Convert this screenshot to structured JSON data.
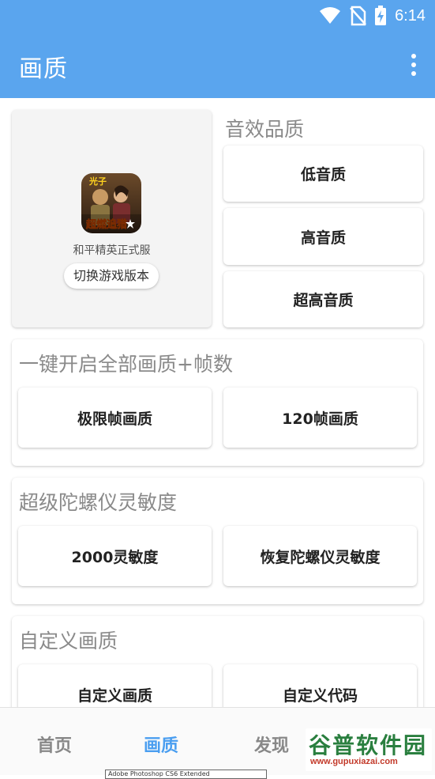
{
  "status_bar": {
    "time": "6:14",
    "icons": [
      "wifi-icon",
      "no-sim-icon",
      "battery-charging-icon"
    ]
  },
  "app_bar": {
    "title": "画质",
    "menu_icon": "more-vert-icon"
  },
  "game_card": {
    "icon_text_top": "光子",
    "icon_text_main": "超燃追猎",
    "name": "和平精英正式服",
    "switch_label": "切换游戏版本"
  },
  "sound_quality": {
    "title": "音效品质",
    "buttons": [
      "低音质",
      "高音质",
      "超高音质"
    ]
  },
  "one_key": {
    "title": "一键开启全部画质+帧数",
    "buttons": [
      "极限帧画质",
      "120帧画质"
    ]
  },
  "gyro": {
    "title": "超级陀螺仪灵敏度",
    "buttons": [
      "2000灵敏度",
      "恢复陀螺仪灵敏度"
    ]
  },
  "custom": {
    "title": "自定义画质",
    "buttons": [
      "自定义画质",
      "自定义代码"
    ]
  },
  "bottom_nav": {
    "items": [
      "首页",
      "画质",
      "发现"
    ],
    "active_index": 1
  },
  "watermark": {
    "title": "谷普软件园",
    "url": "www.gupuxiazai.com"
  },
  "tooltip": "Adobe Photoshop CS6 Extended",
  "colors": {
    "primary": "#5aa5ee",
    "active_tab": "#4a9ef0"
  }
}
